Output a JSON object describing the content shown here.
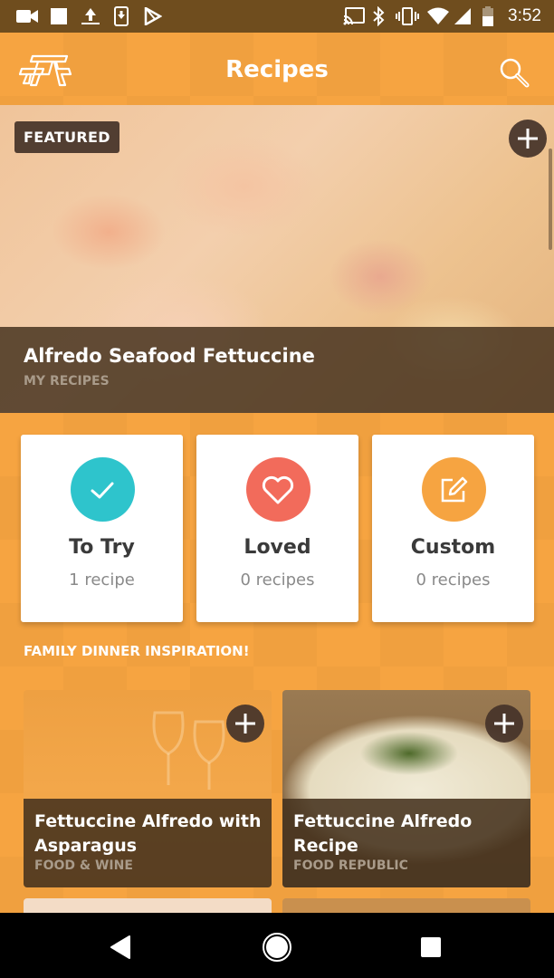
{
  "status_bar": {
    "time": "3:52",
    "left_icons": [
      "video-icon",
      "square-icon",
      "upload-icon",
      "download-icon",
      "play-store-icon"
    ],
    "right_icons": [
      "cast-icon",
      "bluetooth-icon",
      "vibrate-icon",
      "wifi-icon",
      "signal-icon",
      "battery-icon"
    ]
  },
  "app_bar": {
    "title": "Recipes",
    "logo": "picnic-table-logo",
    "search_icon": "search-icon"
  },
  "featured": {
    "badge": "FEATURED",
    "title": "Alfredo Seafood Fettuccine",
    "source": "MY RECIPES"
  },
  "collections": [
    {
      "label": "To Try",
      "count": "1 recipe",
      "icon": "check-icon",
      "color": "#2ec4cc"
    },
    {
      "label": "Loved",
      "count": "0 recipes",
      "icon": "heart-icon",
      "color": "#f26b5b"
    },
    {
      "label": "Custom",
      "count": "0 recipes",
      "icon": "edit-icon",
      "color": "#f6a441"
    }
  ],
  "section": {
    "title": "FAMILY DINNER INSPIRATION!"
  },
  "recipes": [
    {
      "title": "Fettuccine Alfredo with Asparagus",
      "source": "FOOD & WINE"
    },
    {
      "title": "Fettuccine Alfredo Recipe",
      "source": "FOOD REPUBLIC"
    }
  ],
  "colors": {
    "primary": "#f6a441",
    "status_bar": "#6f4d1e",
    "caption_overlay": "#46321e"
  }
}
